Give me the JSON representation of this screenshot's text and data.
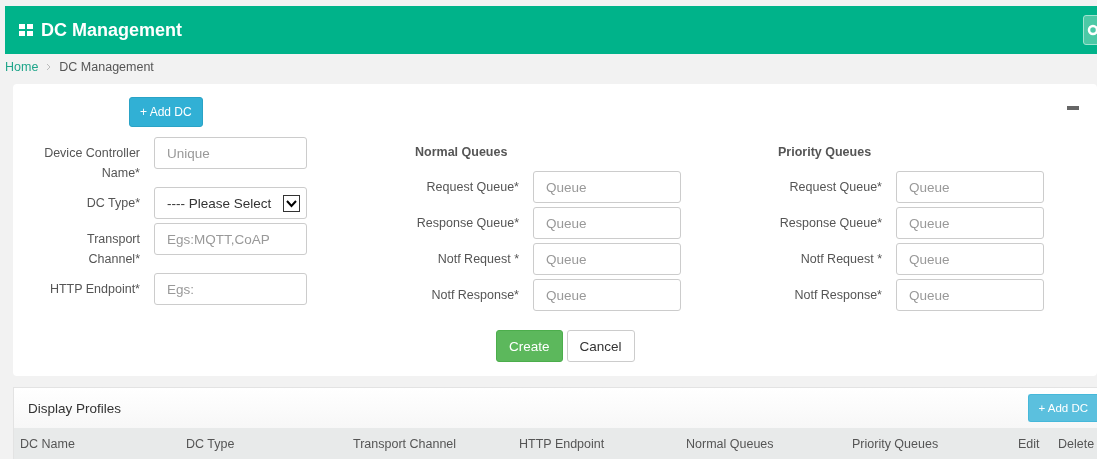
{
  "header": {
    "title": "DC Management"
  },
  "breadcrumb": [
    {
      "label": "Home",
      "link": true
    },
    {
      "label": "DC Management",
      "link": false
    }
  ],
  "form": {
    "add_button": "+ Add DC",
    "collapsed": false,
    "fields": [
      {
        "label": "Device Controller Name*",
        "kind": "text",
        "placeholder": "Unique"
      },
      {
        "label": "DC Type*",
        "kind": "select",
        "value": "---- Please Select"
      },
      {
        "label": "Transport Channel*",
        "kind": "text",
        "placeholder": "Egs:MQTT,CoAP"
      },
      {
        "label": "HTTP Endpoint*",
        "kind": "text",
        "placeholder": "Egs:"
      }
    ],
    "queue_groups": [
      {
        "title": "Normal Queues",
        "fields": [
          {
            "label": "Request Queue*",
            "placeholder": "Queue"
          },
          {
            "label": "Response Queue*",
            "placeholder": "Queue"
          },
          {
            "label": "Notf Request *",
            "placeholder": "Queue"
          },
          {
            "label": "Notf Response*",
            "placeholder": "Queue"
          }
        ]
      },
      {
        "title": "Priority Queues",
        "fields": [
          {
            "label": "Request Queue*",
            "placeholder": "Queue"
          },
          {
            "label": "Response Queue*",
            "placeholder": "Queue"
          },
          {
            "label": "Notf Request *",
            "placeholder": "Queue"
          },
          {
            "label": "Notf Response*",
            "placeholder": "Queue"
          }
        ]
      }
    ],
    "buttons": [
      {
        "label": "Create",
        "kind": "primary"
      },
      {
        "label": "Cancel",
        "kind": "default"
      }
    ]
  },
  "profiles": {
    "title": "Display Profiles",
    "add_button": "+ Add DC",
    "columns": [
      "DC Name",
      "DC Type",
      "Transport Channel",
      "HTTP Endpoint",
      "Normal Queues",
      "Priority Queues",
      "Edit",
      "Delete"
    ]
  }
}
